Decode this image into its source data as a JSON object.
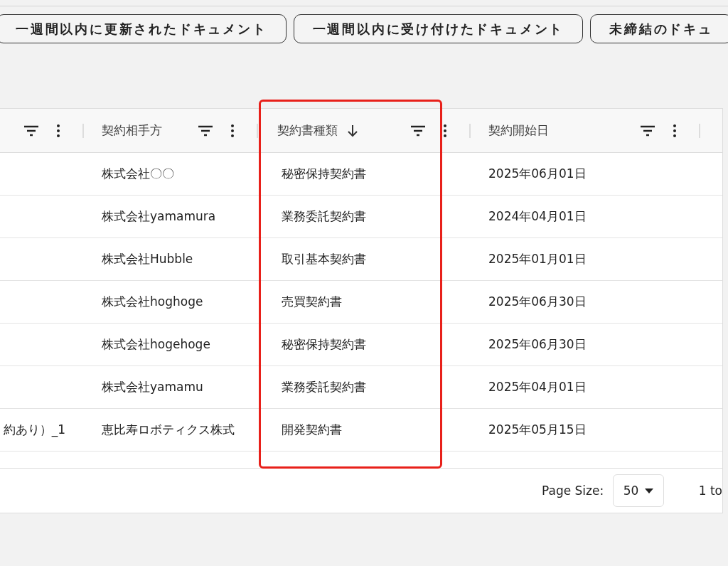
{
  "filter_buttons": [
    {
      "label": "一週間以内に更新されたドキュメント"
    },
    {
      "label": "一週間以内に受け付けたドキュメント"
    },
    {
      "label": "未締結のドキュ"
    }
  ],
  "table": {
    "columns": [
      {
        "sorted": false
      },
      {
        "heading": "契約相手方",
        "sorted": false
      },
      {
        "heading": "契約書種類",
        "sorted": true
      },
      {
        "heading": "契約開始日",
        "sorted": false
      }
    ],
    "rows": [
      {
        "cells": [
          "",
          "株式会社〇〇",
          "秘密保持契約書",
          "2025年06月01日"
        ]
      },
      {
        "cells": [
          "",
          "株式会社yamamura",
          "業務委託契約書",
          "2024年04月01日"
        ]
      },
      {
        "cells": [
          "",
          "株式会社Hubble",
          "取引基本契約書",
          "2025年01月01日"
        ]
      },
      {
        "cells": [
          "",
          "株式会社hoghoge",
          "売買契約書",
          "2025年06月30日"
        ]
      },
      {
        "cells": [
          "",
          "株式会社hogehoge",
          "秘密保持契約書",
          "2025年06月30日"
        ]
      },
      {
        "cells": [
          "",
          "株式会社yamamu",
          "業務委託契約書",
          "2025年04月01日"
        ]
      },
      {
        "cells": [
          "約あり）_1",
          "恵比寿ロボティクス株式",
          "開発契約書",
          "2025年05月15日"
        ]
      }
    ]
  },
  "pagination": {
    "page_size_label": "Page Size:",
    "page_size": "50",
    "range_text": "1 to"
  }
}
